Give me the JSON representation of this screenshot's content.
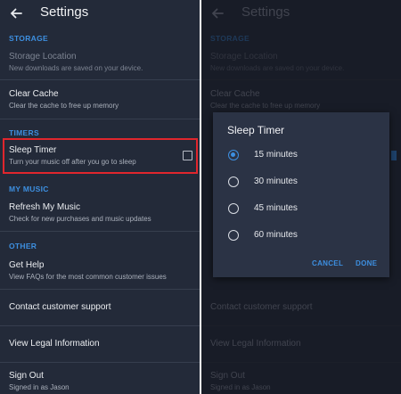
{
  "colors": {
    "accent": "#3d8fe0",
    "highlight": "#e0262d",
    "background": "#232a39"
  },
  "header": {
    "title": "Settings",
    "back_icon": "arrow-left-icon"
  },
  "sections": {
    "storage": "STORAGE",
    "timers": "TIMERS",
    "my_music": "MY MUSIC",
    "other": "OTHER"
  },
  "items": {
    "storage_location": {
      "title": "Storage Location",
      "subtitle": "New downloads are saved on your device."
    },
    "clear_cache": {
      "title": "Clear Cache",
      "subtitle": "Clear the cache to free up memory"
    },
    "sleep_timer": {
      "title": "Sleep Timer",
      "subtitle": "Turn your music off after you go to sleep",
      "checked": false
    },
    "refresh": {
      "title": "Refresh My Music",
      "subtitle": "Check for new purchases and music updates"
    },
    "get_help": {
      "title": "Get Help",
      "subtitle": "View FAQs for the most common customer issues"
    },
    "contact": {
      "title": "Contact customer support"
    },
    "legal": {
      "title": "View Legal Information"
    },
    "sign_out": {
      "title": "Sign Out",
      "subtitle": "Signed in as Jason"
    }
  },
  "dialog": {
    "title": "Sleep Timer",
    "options": [
      "15 minutes",
      "30 minutes",
      "45 minutes",
      "60 minutes"
    ],
    "selected": "15 minutes",
    "cancel": "CANCEL",
    "done": "DONE"
  }
}
